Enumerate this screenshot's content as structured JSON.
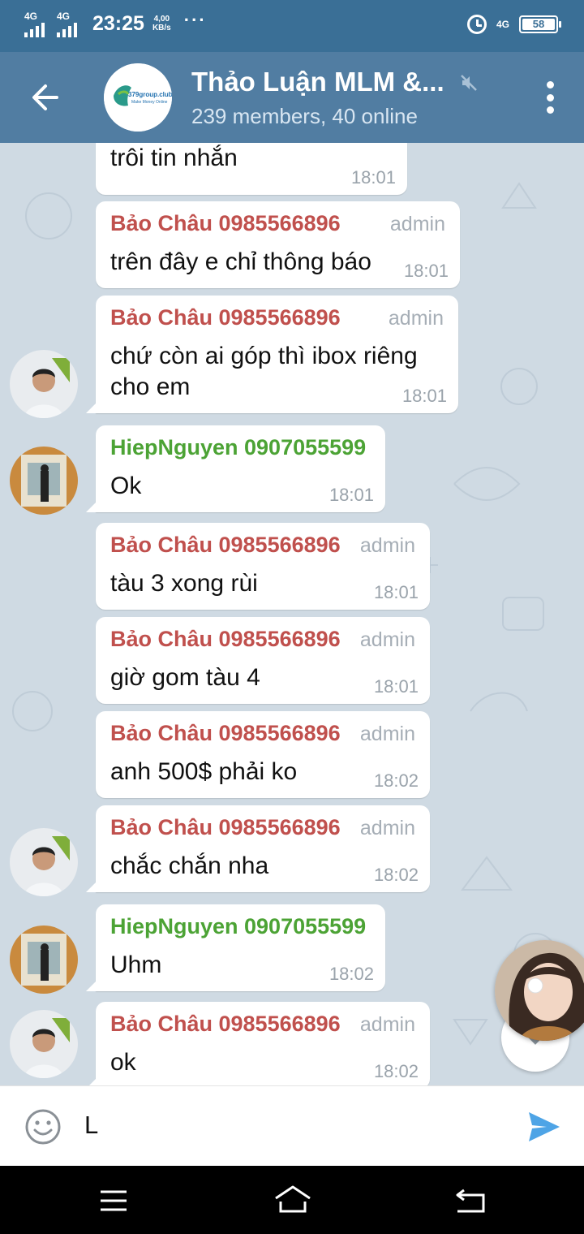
{
  "status_bar": {
    "network_1": "4G",
    "network_2": "4G",
    "time": "23:25",
    "speed_value": "4,00",
    "speed_unit": "KB/s",
    "more": "···",
    "network_right": "4G",
    "battery": "58"
  },
  "header": {
    "title": "Thảo Luận MLM &...",
    "subtitle": "239 members, 40 online",
    "avatar_text": "379group.club",
    "avatar_tagline": "Make Money Online"
  },
  "colors": {
    "header": "#517da2",
    "status_bar": "#3a6f96",
    "admin_name": "#c0504d",
    "member_name": "#4ca335",
    "chat_background": "#cfdae3"
  },
  "messages": [
    {
      "text_lines": [
        "trôi tin nhắn"
      ],
      "time": "18:01"
    },
    {
      "sender": "Bảo Châu 0985566896",
      "role": "admin",
      "text_lines": [
        "trên đây e chỉ thông báo"
      ],
      "time": "18:01"
    },
    {
      "sender": "Bảo Châu 0985566896",
      "role": "admin",
      "text_lines": [
        "chứ còn ai góp thì ibox riêng",
        "cho em"
      ],
      "time": "18:01"
    },
    {
      "sender": "HiepNguyen 0907055599",
      "text_lines": [
        "Ok"
      ],
      "time": "18:01"
    },
    {
      "sender": "Bảo Châu 0985566896",
      "role": "admin",
      "text_lines": [
        "tàu 3 xong rùi"
      ],
      "time": "18:01"
    },
    {
      "sender": "Bảo Châu 0985566896",
      "role": "admin",
      "text_lines": [
        "giờ gom tàu 4"
      ],
      "time": "18:01"
    },
    {
      "sender": "Bảo Châu 0985566896",
      "role": "admin",
      "text_lines": [
        "anh 500$ phải ko"
      ],
      "time": "18:02"
    },
    {
      "sender": "Bảo Châu 0985566896",
      "role": "admin",
      "text_lines": [
        "chắc chắn nha"
      ],
      "time": "18:02"
    },
    {
      "sender": "HiepNguyen 0907055599",
      "text_lines": [
        "Uhm"
      ],
      "time": "18:02"
    },
    {
      "sender": "Bảo Châu 0985566896",
      "role": "admin",
      "text_lines": [
        "ok"
      ],
      "time": "18:02"
    }
  ],
  "input": {
    "value": "L"
  },
  "icons": {
    "back": "arrow-left-icon",
    "mute": "muted-speaker-icon",
    "menu": "vertical-dots-icon",
    "emoji": "smiley-icon",
    "send": "paper-plane-icon",
    "scroll_down": "chevron-down-icon",
    "nav_menu": "hamburger-icon",
    "nav_home": "home-icon",
    "nav_back": "return-icon"
  }
}
